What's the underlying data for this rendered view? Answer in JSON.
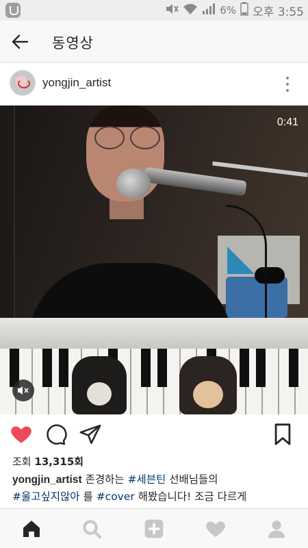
{
  "status_bar": {
    "battery": "6%",
    "time": "오후 3:55"
  },
  "app_bar": {
    "title": "동영상"
  },
  "post": {
    "username": "yongjin_artist",
    "video_duration": "0:41",
    "views_label": "조회",
    "views_count": "13,315회",
    "caption": {
      "user": "yongjin_artist",
      "text_1": " 존경하는 ",
      "tag_1": "#세븐틴",
      "text_2": " 선배님들의",
      "tag_2": "#울고싶지않아",
      "text_3": " 를 ",
      "tag_3": "#cover",
      "text_4": " 해봤습니다! 조금 다르게"
    }
  },
  "icons": {
    "back": "arrow-left-icon",
    "more": "more-vertical-icon",
    "mute": "mute-icon",
    "like": "heart-filled-icon",
    "comment": "comment-icon",
    "share": "send-icon",
    "save": "bookmark-icon",
    "nav": [
      "home-icon",
      "search-icon",
      "add-icon",
      "heart-icon",
      "profile-icon"
    ]
  },
  "colors": {
    "like": "#ed4956",
    "hashtag": "#003569",
    "nav_active": "#262626",
    "nav_inactive": "#c7c7c7"
  }
}
